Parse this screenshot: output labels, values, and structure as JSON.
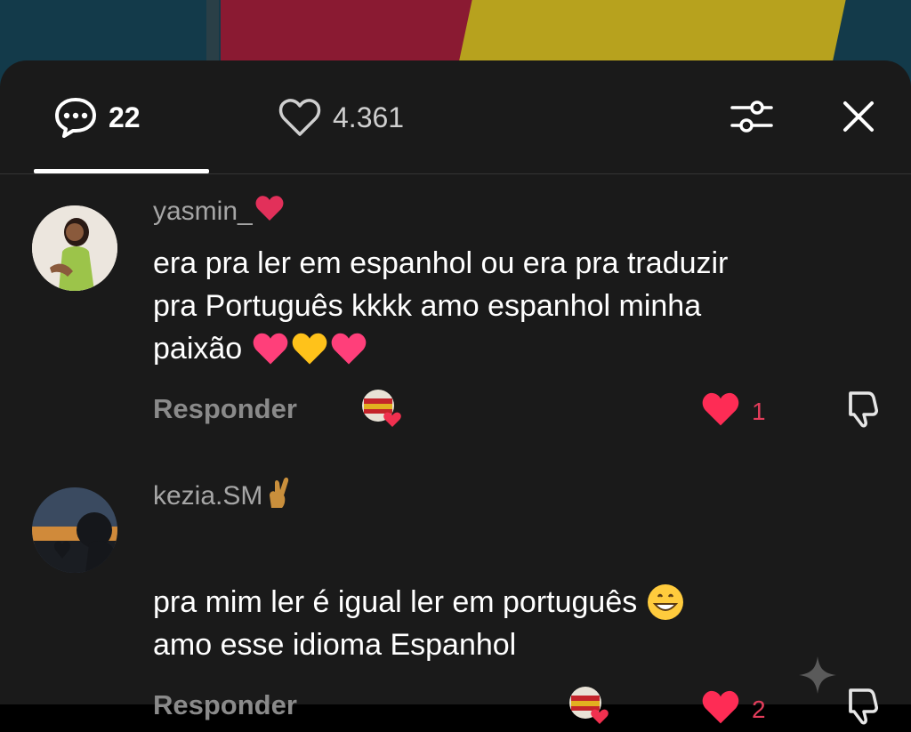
{
  "header": {
    "comments_count": "22",
    "likes_count": "4.361",
    "filter_icon": "sliders-icon",
    "close_icon": "close-icon"
  },
  "comments": [
    {
      "username": "yasmin_",
      "username_emoji": "heart-emoji",
      "lines": [
        "era pra ler em espanhol ou era pra traduzir",
        "pra Português kkkk amo espanhol minha",
        "paixão"
      ],
      "trailing_emoji": "hearts-emoji",
      "reply_label": "Responder",
      "likes": "1"
    },
    {
      "username": "kezia.SM",
      "username_emoji": "crossed-fingers-emoji",
      "lines": [
        "pra mim ler é igual ler em português",
        "amo esse idioma Espanhol"
      ],
      "trailing_emoji": "grinning-emoji",
      "reply_label": "Responder",
      "likes": "2"
    }
  ],
  "colors": {
    "sheet_bg": "#1a1a1a",
    "like_red": "#e33d5b",
    "muted_text": "#8a8a8a"
  }
}
